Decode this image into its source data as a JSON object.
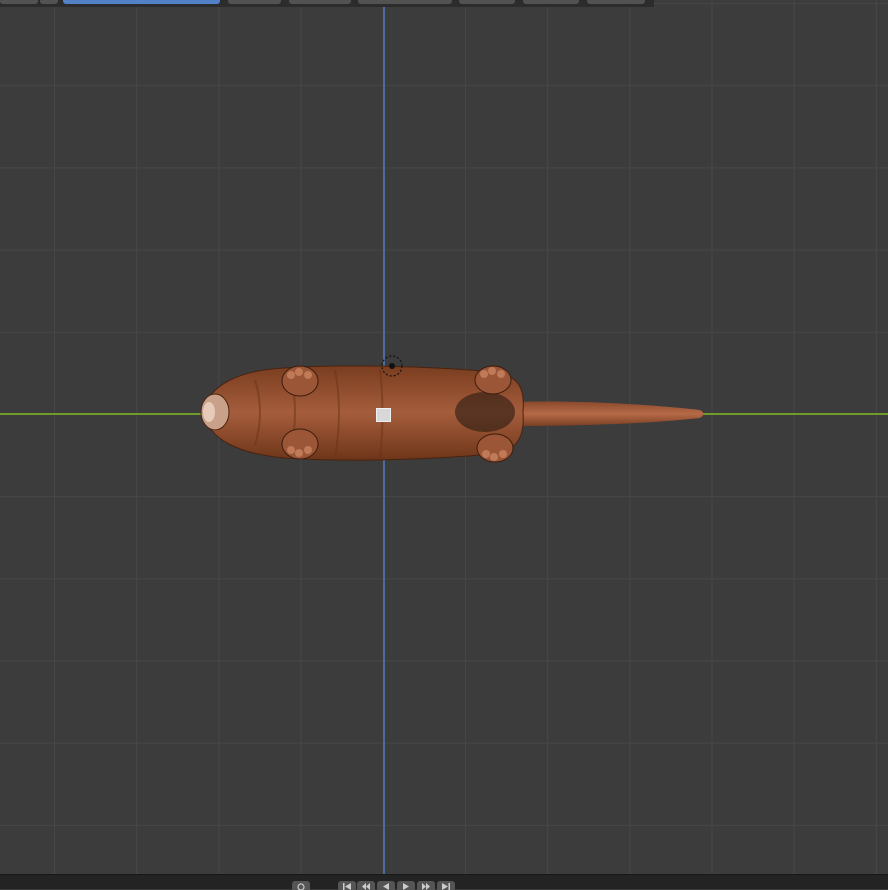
{
  "editor": {
    "name": "3D Viewport",
    "view": "top-orthographic"
  },
  "header": {
    "buttons": [
      {
        "name": "header-mode-select",
        "active": false
      },
      {
        "name": "header-view-menu",
        "active": true
      },
      {
        "name": "header-menu-1",
        "active": false
      },
      {
        "name": "header-menu-2",
        "active": false
      },
      {
        "name": "header-menu-3",
        "active": false
      },
      {
        "name": "header-menu-4",
        "active": false
      },
      {
        "name": "header-menu-5",
        "active": false
      },
      {
        "name": "header-menu-6",
        "active": false
      }
    ]
  },
  "scene": {
    "object": "cat",
    "axis_colors": {
      "x": "#6e9a2e",
      "y": "#4d6c9e"
    },
    "grid_color": "#474747",
    "background": "#3c3c3c"
  },
  "timeline": {
    "controls": [
      "zoom-icon",
      "jump-start-icon",
      "prev-keyframe-icon",
      "play-reverse-icon",
      "play-icon",
      "next-keyframe-icon",
      "jump-end-icon"
    ]
  }
}
